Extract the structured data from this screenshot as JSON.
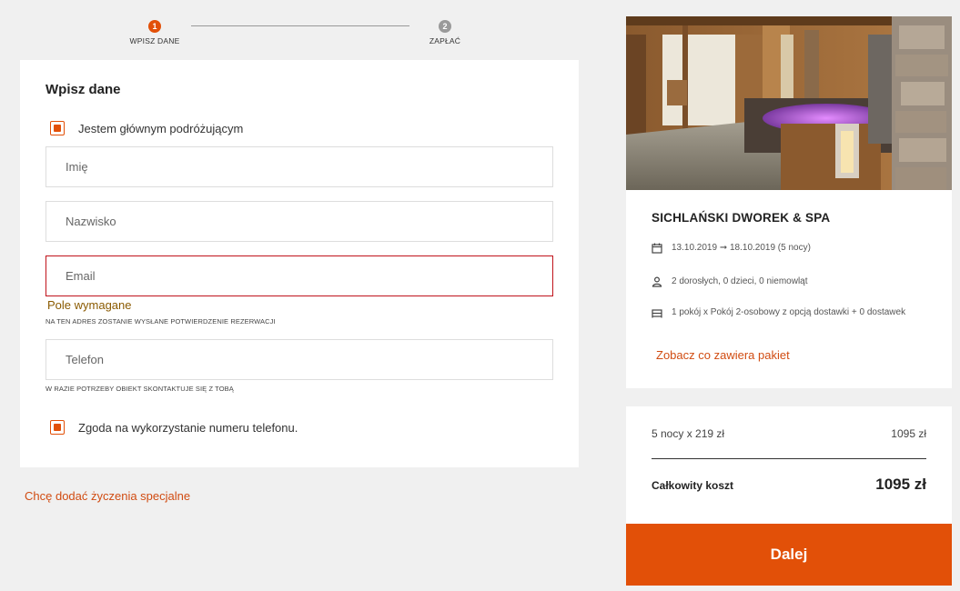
{
  "stepper": {
    "steps": [
      {
        "number": "1",
        "label": "WPISZ DANE"
      },
      {
        "number": "2",
        "label": "ZAPŁAĆ"
      }
    ]
  },
  "form": {
    "title": "Wpisz dane",
    "main_traveler_label": "Jestem głównym podróżującym",
    "first_name_placeholder": "Imię",
    "last_name_placeholder": "Nazwisko",
    "email_placeholder": "Email",
    "email_error": "Pole wymagane",
    "email_hint": "NA TEN ADRES ZOSTANIE WYSŁANE POTWIERDZENIE REZERWACJI",
    "phone_placeholder": "Telefon",
    "phone_hint": "W RAZIE POTRZEBY OBIEKT SKONTAKTUJE SIĘ Z TOBĄ",
    "phone_consent_label": "Zgoda na wykorzystanie numeru telefonu."
  },
  "special_requests_link": "Chcę dodać życzenia specjalne",
  "hotel": {
    "name": "SICHLAŃSKI DWOREK & SPA",
    "dates": "13.10.2019 ➞ 18.10.2019 (5 nocy)",
    "guests": "2 dorosłych, 0 dzieci, 0 niemowląt",
    "room": "1 pokój x Pokój 2-osobowy z opcją dostawki + 0 dostawek",
    "package_link": "Zobacz co zawiera pakiet"
  },
  "price": {
    "nights_label": "5 nocy x 219 zł",
    "nights_total": "1095 zł",
    "total_label": "Całkowity koszt",
    "total_value": "1095 zł"
  },
  "next_button": "Dalej",
  "colors": {
    "accent": "#e25008",
    "link": "#d14c12",
    "error_border": "#c0131b",
    "background": "#f0f0f0"
  }
}
